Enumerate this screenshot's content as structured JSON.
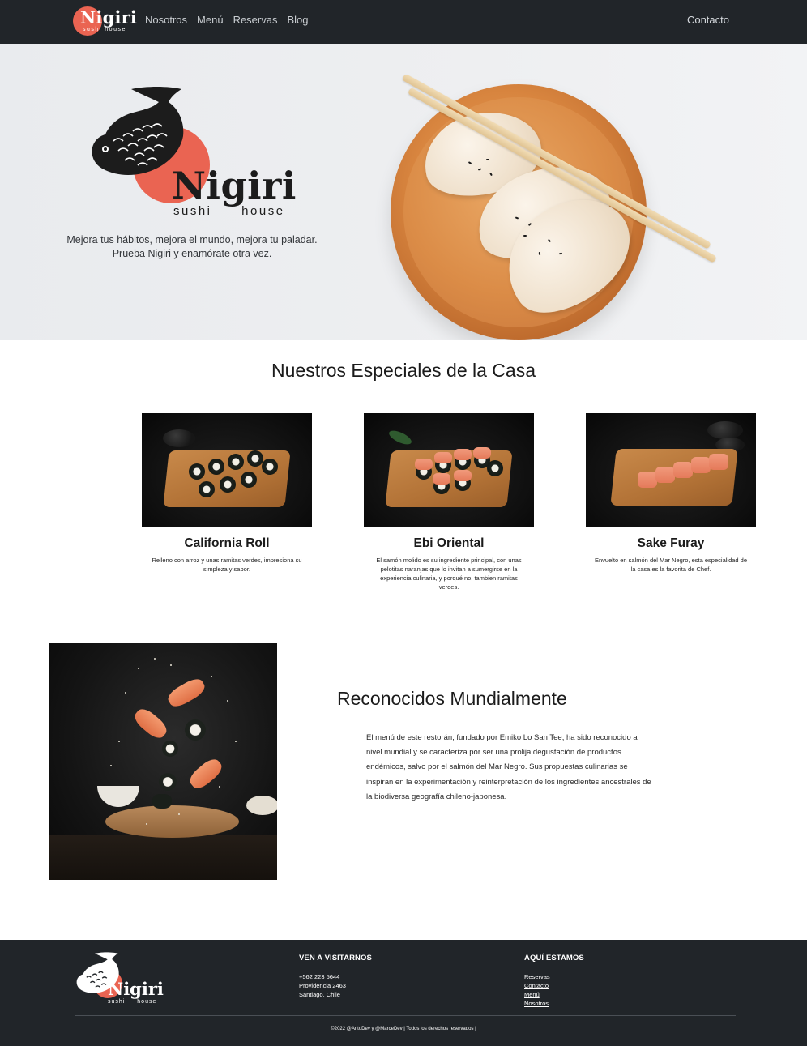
{
  "brand": {
    "name": "Nigiri",
    "sub": "sushi house",
    "accent": "#ea6452",
    "dark": "#212529"
  },
  "nav": {
    "items": [
      {
        "label": "Nosotros"
      },
      {
        "label": "Menú"
      },
      {
        "label": "Reservas"
      },
      {
        "label": "Blog"
      }
    ],
    "contact": "Contacto"
  },
  "hero": {
    "tagline_line1": "Mejora tus hábitos, mejora el mundo, mejora tu paladar.",
    "tagline_line2": "Prueba Nigiri y enamórate otra vez."
  },
  "specials": {
    "title": "Nuestros Especiales de la Casa",
    "items": [
      {
        "name": "California Roll",
        "description": "Relleno con arroz y unas ramitas verdes, impresiona su simpleza y sabor."
      },
      {
        "name": "Ebi Oriental",
        "description": "El samón molido es su ingrediente principal, con unas pelotitas naranjas que lo invitan a sumergirse en la experiencia culinaria, y porqué no, tambien ramitas verdes."
      },
      {
        "name": "Sake Furay",
        "description": "Envuelto en salmón del Mar Negro, esta especialidad de la casa es la favorita de Chef."
      }
    ]
  },
  "recognized": {
    "title": "Reconocidos Mundialmente",
    "text": "El menú de este restorán, fundado por Emiko Lo San Tee, ha sido reconocido a nivel mundial y se caracteriza por ser una prolija degustación de productos endémicos, salvo por el salmón del Mar Negro. Sus propuestas culinarias se inspiran en la experimentación y reinterpretación de los ingredientes ancestrales de la biodiversa geografía chileno-japonesa."
  },
  "footer": {
    "visit_heading": "VEN A VISITARNOS",
    "phone": "+562 223 5644",
    "street": "Providencia 2463",
    "city": "Santiago, Chile",
    "here_heading": "AQUÍ ESTAMOS",
    "links": [
      {
        "label": "Reservas"
      },
      {
        "label": "Contacto"
      },
      {
        "label": "Menú"
      },
      {
        "label": "Nosotros"
      }
    ],
    "copyright": "©2022 @AntoDev y @MarceDev | Todos los derechos reservados |"
  }
}
